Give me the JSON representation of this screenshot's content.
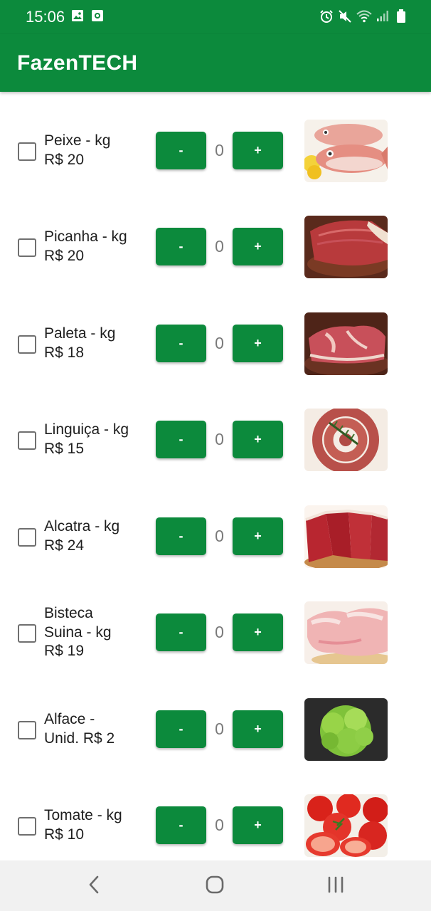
{
  "status_bar": {
    "time": "15:06",
    "left_icons": [
      "image-icon",
      "screen-record-icon"
    ],
    "right_icons": [
      "alarm-icon",
      "mute-icon",
      "wifi-icon",
      "signal-icon",
      "battery-icon"
    ]
  },
  "app_bar": {
    "title": "FazenTECH"
  },
  "colors": {
    "primary": "#0c8a3c",
    "navbar": "#f1f1f1",
    "qty_text": "#7a7a7a"
  },
  "products": [
    {
      "name": "Peixe - kg\nR$ 20",
      "minus": "-",
      "plus": "+",
      "quantity": "0",
      "checked": false,
      "image": "fish-image"
    },
    {
      "name": "Picanha - kg\nR$ 20",
      "minus": "-",
      "plus": "+",
      "quantity": "0",
      "checked": false,
      "image": "picanha-image"
    },
    {
      "name": "Paleta - kg\nR$ 18",
      "minus": "-",
      "plus": "+",
      "quantity": "0",
      "checked": false,
      "image": "paleta-image"
    },
    {
      "name": "Linguiça - kg\nR$ 15",
      "minus": "-",
      "plus": "+",
      "quantity": "0",
      "checked": false,
      "image": "sausage-image"
    },
    {
      "name": "Alcatra - kg\nR$ 24",
      "minus": "-",
      "plus": "+",
      "quantity": "0",
      "checked": false,
      "image": "alcatra-image"
    },
    {
      "name": "Bisteca\nSuina - kg\nR$ 19",
      "minus": "-",
      "plus": "+",
      "quantity": "0",
      "checked": false,
      "image": "pork-chop-image"
    },
    {
      "name": "Alface -\nUnid.   R$ 2",
      "minus": "-",
      "plus": "+",
      "quantity": "0",
      "checked": false,
      "image": "lettuce-image"
    },
    {
      "name": "Tomate - kg\nR$ 10",
      "minus": "-",
      "plus": "+",
      "quantity": "0",
      "checked": false,
      "image": "tomato-image"
    }
  ],
  "nav_bar": {
    "icons": [
      "back-icon",
      "home-icon",
      "recent-apps-icon"
    ]
  }
}
